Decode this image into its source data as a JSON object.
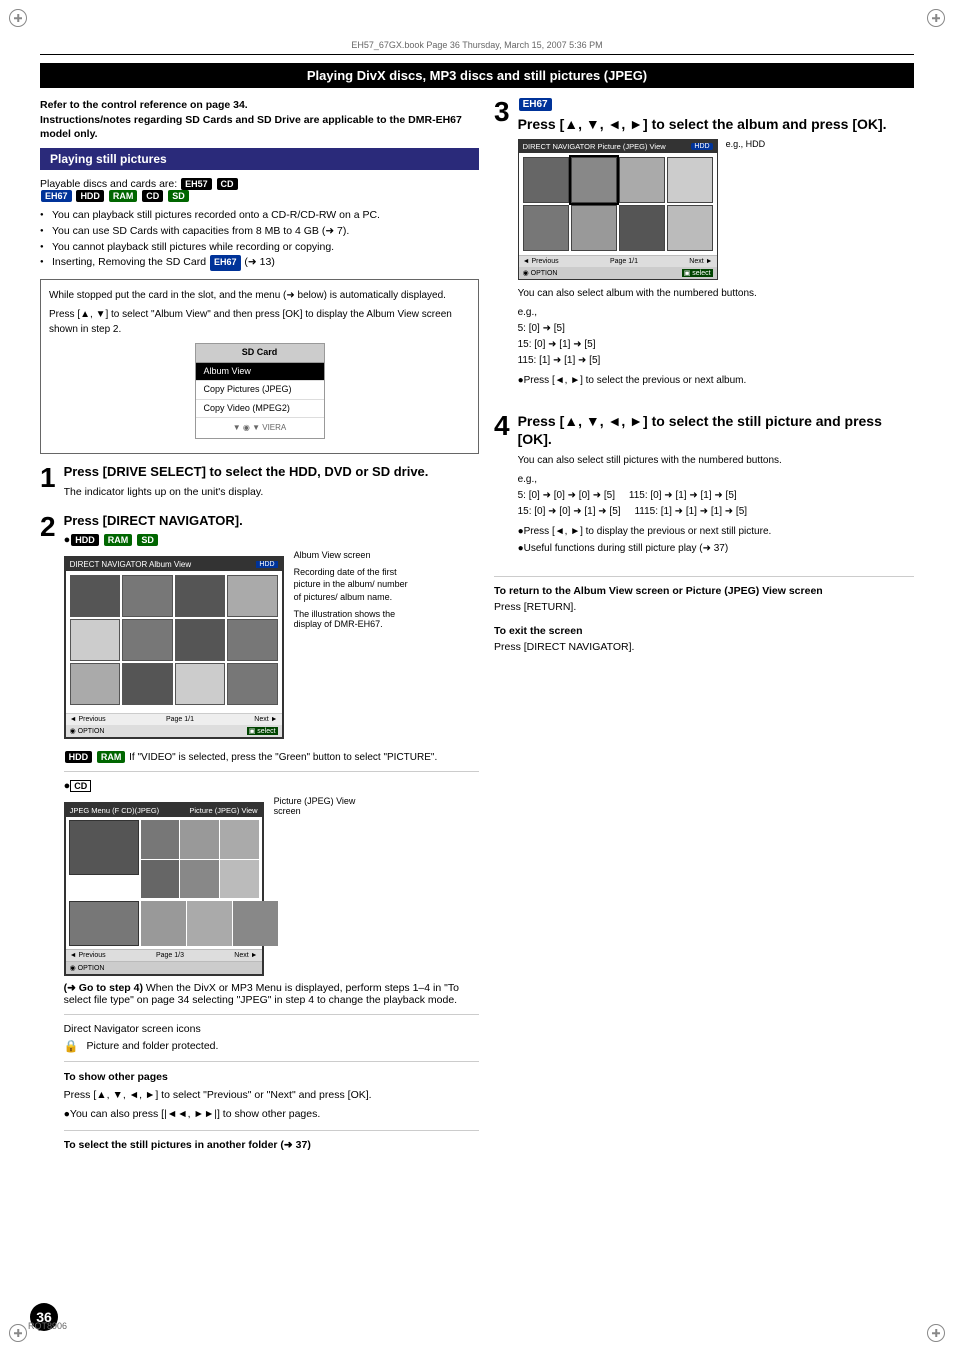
{
  "page": {
    "title": "Playing DivX discs, MP3 discs and still pictures (JPEG)",
    "file_info": "EH57_67GX.book   Page 36   Thursday, March 15, 2007   5:36 PM",
    "page_number": "36",
    "page_code": "RQT8906"
  },
  "refer_section": {
    "line1": "Refer to the control reference on page 34.",
    "line2": "Instructions/notes regarding SD Cards and SD Drive are applicable to the DMR-EH67 model only."
  },
  "still_pictures": {
    "heading": "Playing still pictures",
    "playable_label": "Playable discs and cards are:",
    "badge_eh57": "EH57",
    "badge_cd": "CD",
    "badge_eh67": "EH67",
    "badge_hdd": "HDD",
    "badge_ram": "RAM",
    "badge_cd2": "CD",
    "badge_sd": "SD",
    "bullets": [
      "You can playback still pictures recorded onto a CD-R/CD-RW on a PC.",
      "You can use SD Cards with capacities from 8 MB to 4 GB (➜ 7).",
      "You cannot playback still pictures while recording or copying.",
      "Inserting, Removing the SD Card EH67 (➜ 13)"
    ],
    "note_box": {
      "line1": "While stopped put the card in the slot, and the menu (➜ below) is automatically displayed.",
      "line2": "Press [▲, ▼] to select \"Album View\" and then press [OK] to display the Album View screen shown in step 2.",
      "sd_menu_title": "SD Card",
      "sd_menu_items": [
        "Album View",
        "Copy Pictures (JPEG)",
        "Copy Video (MPEG2)"
      ]
    }
  },
  "step1": {
    "number": "1",
    "title": "Press [DRIVE SELECT] to select the HDD, DVD or SD drive.",
    "desc": "The indicator lights up on the unit's display."
  },
  "step2": {
    "number": "2",
    "title": "Press [DIRECT NAVIGATOR].",
    "badge_hdd": "HDD",
    "badge_ram": "RAM",
    "badge_sd": "SD",
    "screen_label": "Album View screen",
    "screen_header": "DIRECT NAVIGATOR   Album View",
    "recording_info_label": "Recording date of the first picture in the album/ number of pictures/ album name.",
    "illustration_label": "The illustration shows the display of DMR-EH67.",
    "hdd_ram_note": "If \"VIDEO\" is selected, press the \"Green\" button to select \"PICTURE\".",
    "cd_label": "CD",
    "cd_screen_label": "Picture (JPEG) View screen",
    "cd_screen_header_left": "JPEG Menu (F CD)(JPEG)",
    "cd_screen_header_right": "Picture (JPEG) View",
    "go_step4_label": "(➜ Go to step 4)",
    "go_step4_desc": "When the DivX or MP3 Menu is displayed, perform steps 1–4 in \"To select file type\" on page 34 selecting \"JPEG\" in step 4 to change the playback mode.",
    "direct_nav_icons_label": "Direct Navigator screen icons",
    "lock_icon_desc": "Picture and folder protected.",
    "to_show_pages_title": "To show other pages",
    "to_show_pages_desc": "Press [▲, ▼, ◄, ►] to select \"Previous\" or \"Next\" and press [OK].",
    "to_show_pages_note": "●You can also press [|◄◄, ►►|] to show other pages.",
    "to_select_title": "To select the still pictures in another folder (➜ 37)"
  },
  "step3": {
    "number": "3",
    "badge": "EH67",
    "title": "Press [▲, ▼, ◄, ►] to select the album and press [OK].",
    "eg_label": "e.g., HDD",
    "screen_header_left": "DIRECT NAVIGATOR   Picture (JPEG) View",
    "screen_hdd_badge": "HDD",
    "eg_desc": "You can also select album with the numbered buttons.",
    "eg_prefix": "e.g.,",
    "numbered_5": "5:    [0] ➜ [5]",
    "numbered_15": "15:  [0] ➜ [1] ➜ [5]",
    "numbered_115": "115: [1] ➜ [1] ➜ [5]",
    "press_arrows": "●Press [◄, ►] to select the previous or next album."
  },
  "step4": {
    "number": "4",
    "title": "Press [▲, ▼, ◄, ►] to select the still picture and press [OK].",
    "desc": "You can also select still pictures with the numbered buttons.",
    "eg_prefix": "e.g.,",
    "numbered_5_left": "5:    [0] ➜ [0] ➜ [0] ➜ [5]",
    "numbered_5_right": "115:  [0] ➜ [1] ➜ [1] ➜ [5]",
    "numbered_15_left": "15:  [0] ➜ [0] ➜ [1] ➜ [5]",
    "numbered_15_right": "1115: [1] ➜ [1] ➜ [1] ➜ [5]",
    "press_arrows": "●Press [◄, ►] to display the previous or next still picture.",
    "useful": "●Useful functions during still picture play (➜ 37)"
  },
  "bottom_info": {
    "return_title": "To return to the Album View screen or Picture (JPEG) View screen",
    "return_desc": "Press [RETURN].",
    "exit_title": "To exit the screen",
    "exit_desc": "Press [DIRECT NAVIGATOR]."
  }
}
